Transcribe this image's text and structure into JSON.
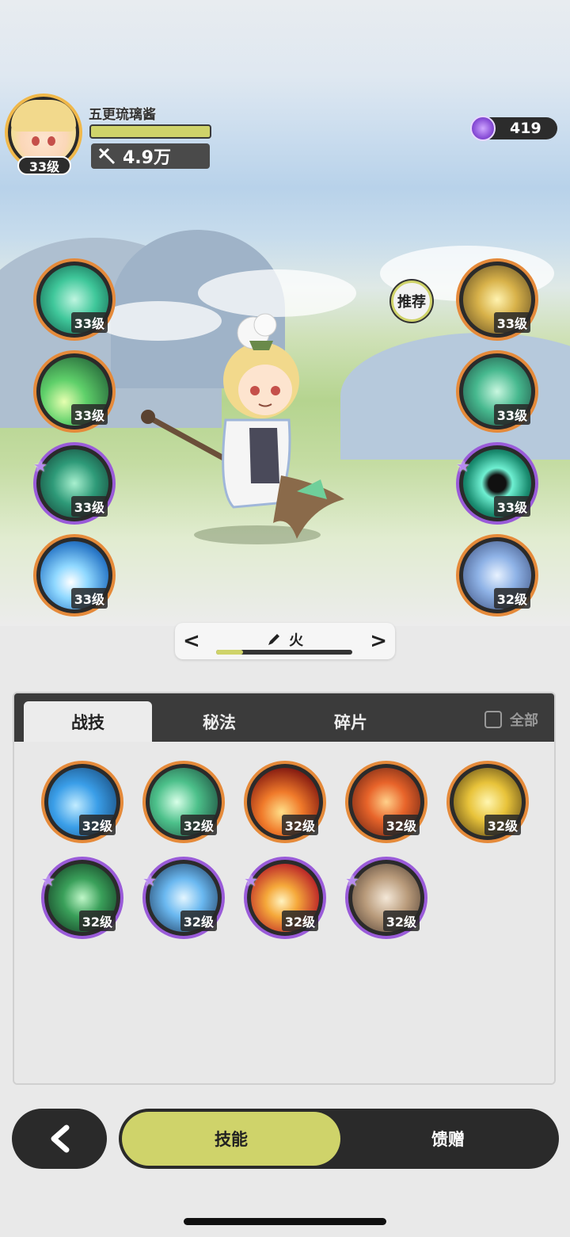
{
  "player": {
    "name": "五更琉璃酱",
    "level": "33级",
    "power": "4.9万",
    "hp_fraction": 1.0
  },
  "currency": {
    "amount": "419",
    "icon": "purple-gem-icon"
  },
  "recommend_label": "推荐",
  "equipped_left": [
    {
      "level": "33级",
      "icon": "wind-spiral-icon",
      "rarity": "orange",
      "starred": false
    },
    {
      "level": "33级",
      "icon": "green-comet-icon",
      "rarity": "orange",
      "starred": false
    },
    {
      "level": "33级",
      "icon": "thorn-vortex-icon",
      "rarity": "purple",
      "starred": true
    },
    {
      "level": "33级",
      "icon": "ice-burst-icon",
      "rarity": "orange",
      "starred": false
    }
  ],
  "equipped_right": [
    {
      "level": "33级",
      "icon": "golden-arrows-icon",
      "rarity": "orange",
      "starred": false
    },
    {
      "level": "33级",
      "icon": "green-clover-icon",
      "rarity": "orange",
      "starred": false
    },
    {
      "level": "33级",
      "icon": "teal-vortex-icon",
      "rarity": "purple",
      "starred": true
    },
    {
      "level": "32级",
      "icon": "blue-crystal-icon",
      "rarity": "orange",
      "starred": false
    }
  ],
  "selector": {
    "label": "火",
    "prev": "<",
    "next": ">",
    "edit_icon": "pencil-icon",
    "progress": 0.2
  },
  "tabs": [
    {
      "label": "战技",
      "active": true
    },
    {
      "label": "秘法",
      "active": false
    },
    {
      "label": "碎片",
      "active": false
    }
  ],
  "all_toggle": {
    "label": "全部",
    "checked": false
  },
  "skills": [
    {
      "level": "32级",
      "icon": "water-splash-icon",
      "rarity": "orange",
      "starred": false
    },
    {
      "level": "32级",
      "icon": "green-slash-icon",
      "rarity": "orange",
      "starred": false
    },
    {
      "level": "32级",
      "icon": "flame-icon",
      "rarity": "orange",
      "starred": false
    },
    {
      "level": "32级",
      "icon": "fire-swirl-icon",
      "rarity": "orange",
      "starred": false
    },
    {
      "level": "32级",
      "icon": "golden-crystal-icon",
      "rarity": "orange",
      "starred": false
    },
    {
      "level": "32级",
      "icon": "green-plus-icon",
      "rarity": "purple",
      "starred": true
    },
    {
      "level": "32级",
      "icon": "ice-shard-icon",
      "rarity": "purple",
      "starred": true
    },
    {
      "level": "32级",
      "icon": "fireball-icon",
      "rarity": "purple",
      "starred": true
    },
    {
      "level": "32级",
      "icon": "rock-cards-icon",
      "rarity": "purple",
      "starred": true
    }
  ],
  "bottom": {
    "back_icon": "back-arrow-icon",
    "tab_skill": "技能",
    "tab_gift": "馈赠"
  },
  "colors": {
    "accent": "#cfd36a",
    "orange_ring": "#e58a3a",
    "purple_ring": "#9a5bd9",
    "dark": "#2a2a2a"
  }
}
